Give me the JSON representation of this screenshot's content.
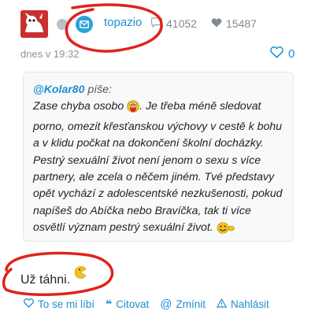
{
  "post": {
    "username": "topazio",
    "comments_count": "41052",
    "likes_count": "15487",
    "date": "dnes v 19:32",
    "heart_count": "0"
  },
  "quote": {
    "author": "@Kolar80",
    "says": "píše:",
    "line1": "Zase chyba osobo",
    "line1_rest": ". Je třeba méně sledovat porno, omezit křesťanskou výchovy v cestě k bohu a v klidu počkat na dokončení školní docházky. Pestrý sexuální život není jenom o sexu s více partnery, ale zcela o něčem jiném. Tvé představy opět vychází z adolescentské nezkušenosti, pokud napíšeš do Abíčka nebo Bravíčka, tak ti více osvětlí význam pestrý sexuální život."
  },
  "reply": {
    "text": "Už táhni."
  },
  "actions": {
    "like": "To se mi líbí",
    "quote": "Citovat",
    "mention": "Zmínit",
    "report": "Nahlásit"
  },
  "colors": {
    "accent": "#1f8fd0",
    "annotation": "#e0231c"
  }
}
